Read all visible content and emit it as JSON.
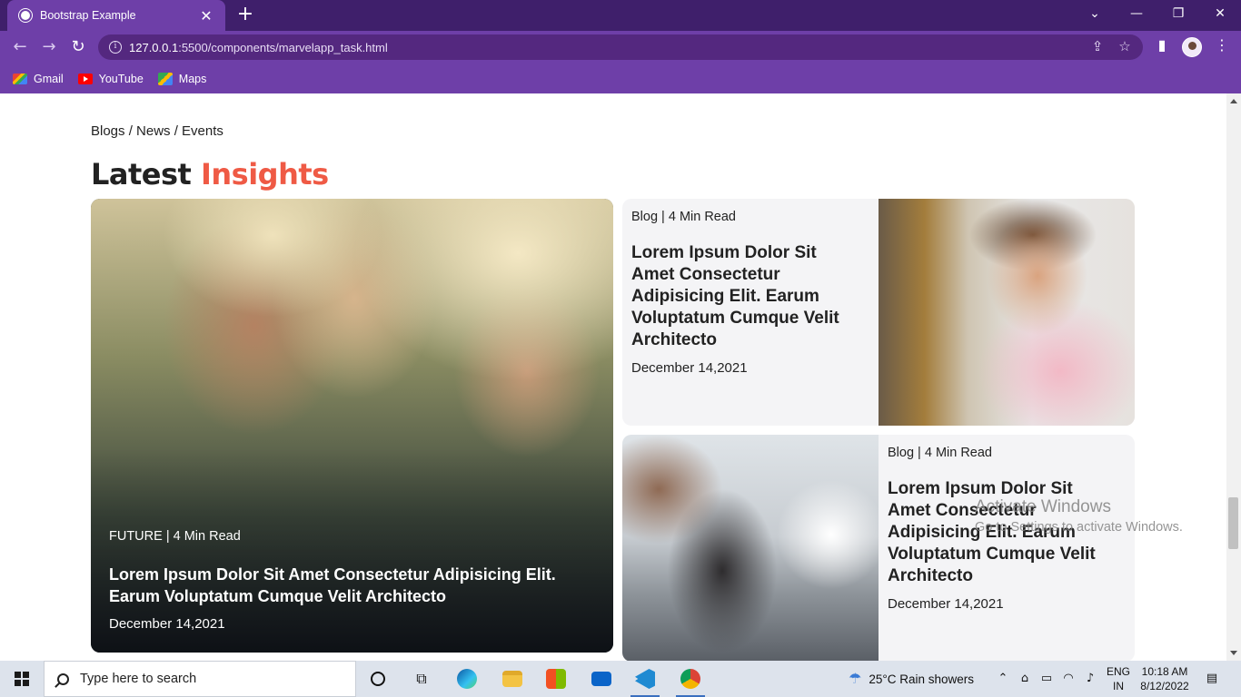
{
  "browser": {
    "tab_title": "Bootstrap Example",
    "tab_close": "✕",
    "new_tab": "+",
    "url_host": "127.0.0.1",
    "url_path": ":5500/components/marvelapp_task.html",
    "bookmarks": [
      {
        "label": "Gmail",
        "icon": "gmail-icon"
      },
      {
        "label": "YouTube",
        "icon": "youtube-icon"
      },
      {
        "label": "Maps",
        "icon": "maps-icon"
      }
    ],
    "window_controls": {
      "chevron": "⌄",
      "minimize": "—",
      "restore": "❐",
      "close": "✕"
    }
  },
  "page": {
    "breadcrumb": "Blogs / News / Events",
    "heading": {
      "plain": "Latest ",
      "accent": "Insights"
    },
    "accent_color": "#ef5a45",
    "featured": {
      "meta": "FUTURE | 4 Min Read",
      "title": "Lorem Ipsum Dolor Sit Amet Consectetur Adipisicing Elit. Earum Voluptatum Cumque Velit Architecto",
      "date": "December 14,2021"
    },
    "cards": [
      {
        "meta": "Blog | 4 Min Read",
        "title": "Lorem Ipsum Dolor Sit Amet Consectetur Adipisicing Elit. Earum Voluptatum Cumque Velit Architecto",
        "date": "December 14,2021"
      },
      {
        "meta": "Blog | 4 Min Read",
        "title": "Lorem Ipsum Dolor Sit Amet Consectetur Adipisicing Elit. Earum Voluptatum Cumque Velit Architecto",
        "date": "December 14,2021"
      }
    ],
    "watermark": {
      "title": "Activate Windows",
      "subtitle": "Go to Settings to activate Windows."
    }
  },
  "taskbar": {
    "search_placeholder": "Type here to search",
    "weather": "25°C  Rain showers",
    "language": {
      "line1": "ENG",
      "line2": "IN"
    },
    "clock": {
      "time": "10:18 AM",
      "date": "8/12/2022"
    },
    "apps": [
      "task-view",
      "widgets",
      "edge",
      "file-explorer",
      "microsoft-store",
      "mail",
      "vscode",
      "chrome"
    ]
  }
}
